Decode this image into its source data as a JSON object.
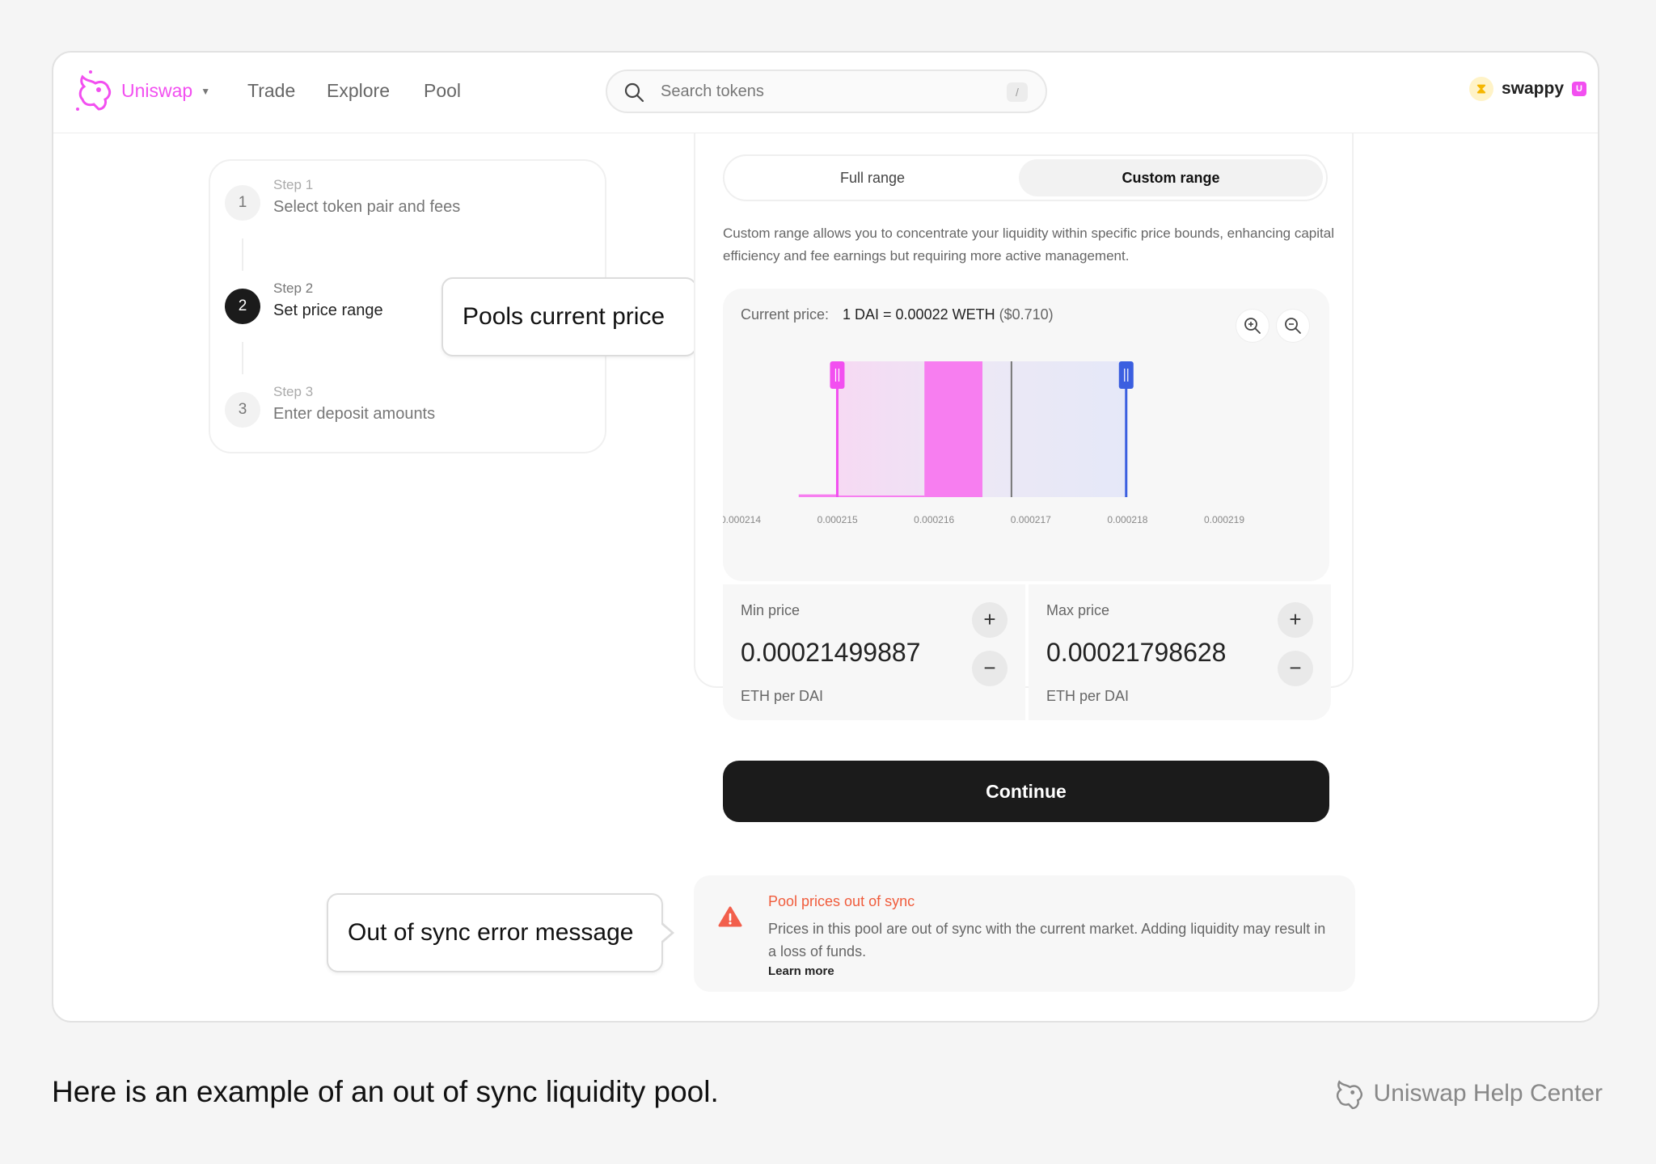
{
  "nav": {
    "brand": "Uniswap",
    "links": [
      "Trade",
      "Explore",
      "Pool"
    ],
    "search_placeholder": "Search tokens",
    "search_shortcut": "/",
    "user_name": "swappy",
    "user_badge": "U"
  },
  "steps": [
    {
      "kicker": "Step 1",
      "title": "Select token pair and fees",
      "number": "1",
      "active": false
    },
    {
      "kicker": "Step 2",
      "title": "Set price range",
      "number": "2",
      "active": true
    },
    {
      "kicker": "Step 3",
      "title": "Enter deposit amounts",
      "number": "3",
      "active": false
    }
  ],
  "callouts": {
    "current_price": "Pools current price",
    "out_of_sync": "Out of sync error message"
  },
  "range_toggle": {
    "full": "Full range",
    "custom": "Custom range",
    "selected": "custom"
  },
  "description": "Custom range allows you to concentrate your liquidity within specific price bounds, enhancing capital efficiency and fee earnings but requiring more active management.",
  "chart": {
    "current_price_label": "Current price:",
    "current_price_value": "1 DAI = 0.00022 WETH",
    "current_price_usd": "($0.710)",
    "x_ticks": [
      "0.000214",
      "0.000215",
      "0.000216",
      "0.000217",
      "0.000218",
      "0.000219"
    ],
    "colors": {
      "min_handle": "#f24ff0",
      "max_handle": "#3b5fe0",
      "liquidity": "#f77ef0"
    }
  },
  "chart_data": {
    "type": "area",
    "x_ticks": [
      "0.000214",
      "0.000215",
      "0.000216",
      "0.000217",
      "0.000218",
      "0.000219"
    ],
    "xlim": [
      0.000214,
      0.000219
    ],
    "liquidity_bars": [
      {
        "x_start": 0.0002146,
        "x_end": 0.000215,
        "relative_height": 0.02
      },
      {
        "x_start": 0.000215,
        "x_end": 0.0002159,
        "relative_height": 0.01
      },
      {
        "x_start": 0.0002159,
        "x_end": 0.0002165,
        "relative_height": 1.0
      }
    ],
    "current_price": 0.0002168,
    "min_price": 0.00021499887,
    "max_price": 0.00021798628
  },
  "min_price": {
    "label": "Min price",
    "value": "0.00021499887",
    "unit": "ETH per DAI"
  },
  "max_price": {
    "label": "Max price",
    "value": "0.00021798628",
    "unit": "ETH per DAI"
  },
  "continue_label": "Continue",
  "alert": {
    "title": "Pool prices out of sync",
    "body": "Prices in this pool are out of sync with the current market. Adding liquidity may result in a loss of funds.",
    "link": "Learn more"
  },
  "caption": "Here is an example of an out of sync liquidity pool.",
  "footer_brand": "Uniswap Help Center"
}
